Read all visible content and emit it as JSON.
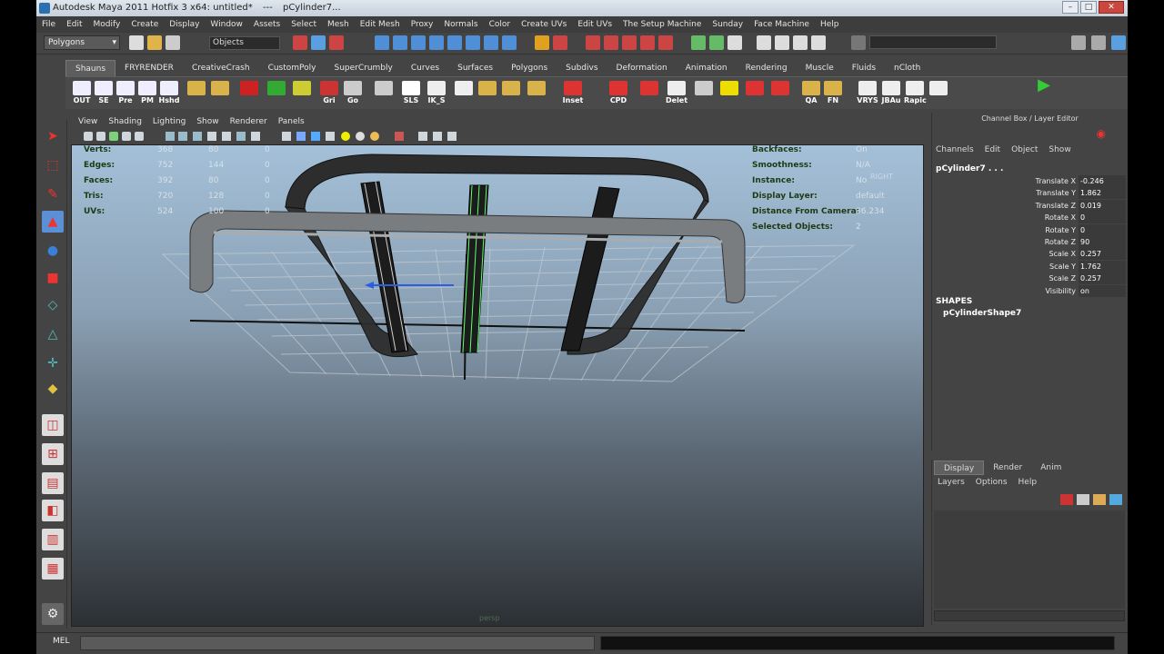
{
  "window": {
    "title": "Autodesk Maya 2011 Hotfix 3 x64: untitled*",
    "separator": "---",
    "selection": "pCylinder7..."
  },
  "menus": [
    "File",
    "Edit",
    "Modify",
    "Create",
    "Display",
    "Window",
    "Assets",
    "Select",
    "Mesh",
    "Edit Mesh",
    "Proxy",
    "Normals",
    "Color",
    "Create UVs",
    "Edit UVs",
    "The Setup Machine",
    "Sunday",
    "Face Machine",
    "Help"
  ],
  "statusline": {
    "mode": "Polygons",
    "selection_field": "Objects"
  },
  "shelf_tabs": [
    "Shauns",
    "FRYRENDER",
    "CreativeCrash",
    "CustomPoly",
    "SuperCrumbly",
    "Curves",
    "Surfaces",
    "Polygons",
    "Subdivs",
    "Deformation",
    "Animation",
    "Rendering",
    "Muscle",
    "Fluids",
    "nCloth"
  ],
  "shelf_active": "Shauns",
  "shelf_buttons": [
    "OUT",
    "SE",
    "Pre",
    "PM",
    "Hshd",
    "",
    "",
    "",
    "",
    "",
    "Gri",
    "Go",
    "",
    "SLS",
    "IK_S",
    "",
    "",
    "",
    "",
    "Inset",
    "CPD",
    "",
    "Delet",
    "",
    "",
    "",
    "",
    "QA",
    "FN",
    "VRYS",
    "JBAu",
    "Rapic",
    ""
  ],
  "viewport_menu": [
    "View",
    "Shading",
    "Lighting",
    "Show",
    "Renderer",
    "Panels"
  ],
  "hud_left": [
    {
      "label": "Verts:",
      "a": "368",
      "b": "80",
      "c": "0"
    },
    {
      "label": "Edges:",
      "a": "752",
      "b": "144",
      "c": "0"
    },
    {
      "label": "Faces:",
      "a": "392",
      "b": "80",
      "c": "0"
    },
    {
      "label": "Tris:",
      "a": "720",
      "b": "128",
      "c": "0"
    },
    {
      "label": "UVs:",
      "a": "524",
      "b": "100",
      "c": "0"
    }
  ],
  "hud_right": [
    {
      "label": "Backfaces:",
      "value": "On"
    },
    {
      "label": "Smoothness:",
      "value": "N/A"
    },
    {
      "label": "Instance:",
      "value": "No"
    },
    {
      "label": "Display Layer:",
      "value": "default"
    },
    {
      "label": "Distance From Camera:",
      "value": "36.234"
    },
    {
      "label": "Selected Objects:",
      "value": "2"
    }
  ],
  "camera_label": "RIGHT",
  "camera_name": "persp",
  "channel_box": {
    "title": "Channel Box / Layer Editor",
    "menu": [
      "Channels",
      "Edit",
      "Object",
      "Show"
    ],
    "object": "pCylinder7 . . .",
    "attributes": [
      {
        "name": "Translate X",
        "value": "-0.246"
      },
      {
        "name": "Translate Y",
        "value": "1.862"
      },
      {
        "name": "Translate Z",
        "value": "0.019"
      },
      {
        "name": "Rotate X",
        "value": "0"
      },
      {
        "name": "Rotate Y",
        "value": "0"
      },
      {
        "name": "Rotate Z",
        "value": "90"
      },
      {
        "name": "Scale X",
        "value": "0.257"
      },
      {
        "name": "Scale Y",
        "value": "1.762"
      },
      {
        "name": "Scale Z",
        "value": "0.257"
      },
      {
        "name": "Visibility",
        "value": "on"
      }
    ],
    "shapes_heading": "SHAPES",
    "shape": "pCylinderShape7"
  },
  "layer_editor": {
    "tabs": [
      "Display",
      "Render",
      "Anim"
    ],
    "active": "Display",
    "menu": [
      "Layers",
      "Options",
      "Help"
    ]
  },
  "command_line": {
    "label": "MEL"
  }
}
